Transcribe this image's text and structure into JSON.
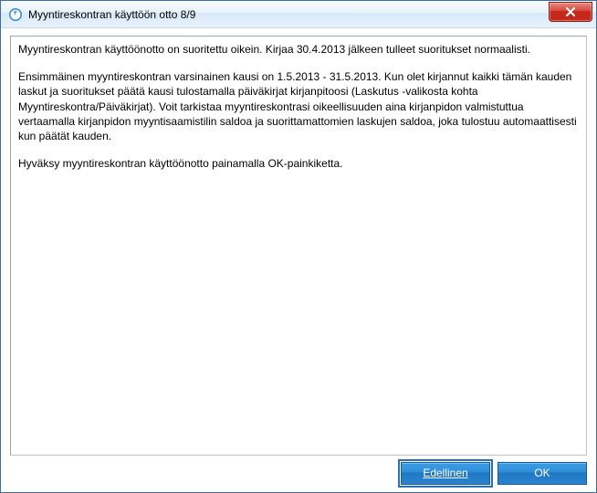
{
  "window": {
    "title": "Myyntireskontran käyttöön otto 8/9"
  },
  "content": {
    "paragraph1": "Myyntireskontran käyttöönotto on suoritettu oikein. Kirjaa 30.4.2013 jälkeen tulleet suoritukset normaalisti.",
    "paragraph2": "Ensimmäinen myyntireskontran varsinainen kausi on 1.5.2013 - 31.5.2013. Kun olet kirjannut kaikki tämän kauden laskut ja suoritukset päätä kausi tulostamalla päiväkirjat kirjanpitoosi (Laskutus -valikosta kohta Myyntireskontra/Päiväkirjat). Voit tarkistaa myyntireskontrasi oikeellisuuden aina kirjanpidon valmistuttua vertaamalla kirjanpidon myyntisaamistilin saldoa ja suorittamattomien laskujen saldoa, joka tulostuu automaattisesti kun päätät kauden.",
    "paragraph3": "Hyväksy myyntireskontran käyttöönotto painamalla OK-painkiketta."
  },
  "buttons": {
    "previous": "Edellinen",
    "ok": "OK"
  }
}
